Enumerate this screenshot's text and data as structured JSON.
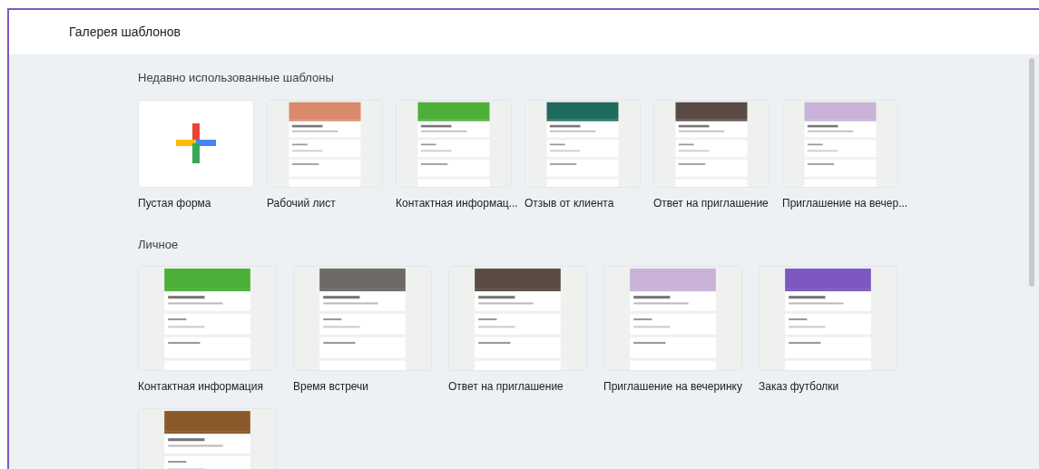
{
  "window": {
    "title": "Галерея шаблонов"
  },
  "sections": [
    {
      "title": "Недавно использованные шаблоны",
      "kind": "small",
      "templates": [
        {
          "name": "Пустая форма",
          "kind": "blank"
        },
        {
          "name": "Рабочий лист",
          "kind": "picture",
          "color": "#d98a6a"
        },
        {
          "name": "Контактная информац...",
          "kind": "picture",
          "color": "#4caf38"
        },
        {
          "name": "Отзыв от клиента",
          "kind": "picture",
          "color": "#1f6b5e"
        },
        {
          "name": "Ответ на приглашение",
          "kind": "picture",
          "color": "#5a4a44"
        },
        {
          "name": "Приглашение на вечер...",
          "kind": "picture",
          "color": "#c9b2d8"
        }
      ]
    },
    {
      "title": "Личное",
      "kind": "large",
      "templates": [
        {
          "name": "Контактная информация",
          "kind": "picture",
          "color": "#4caf38"
        },
        {
          "name": "Время встречи",
          "kind": "picture",
          "color": "#6d6a66"
        },
        {
          "name": "Ответ на приглашение",
          "kind": "picture",
          "color": "#5a4a44"
        },
        {
          "name": "Приглашение на вечеринку",
          "kind": "picture",
          "color": "#c9b2d8"
        },
        {
          "name": "Заказ футболки",
          "kind": "picture",
          "color": "#7e57c2"
        },
        {
          "kind": "picture",
          "color": "#8a5a2a"
        }
      ]
    }
  ]
}
